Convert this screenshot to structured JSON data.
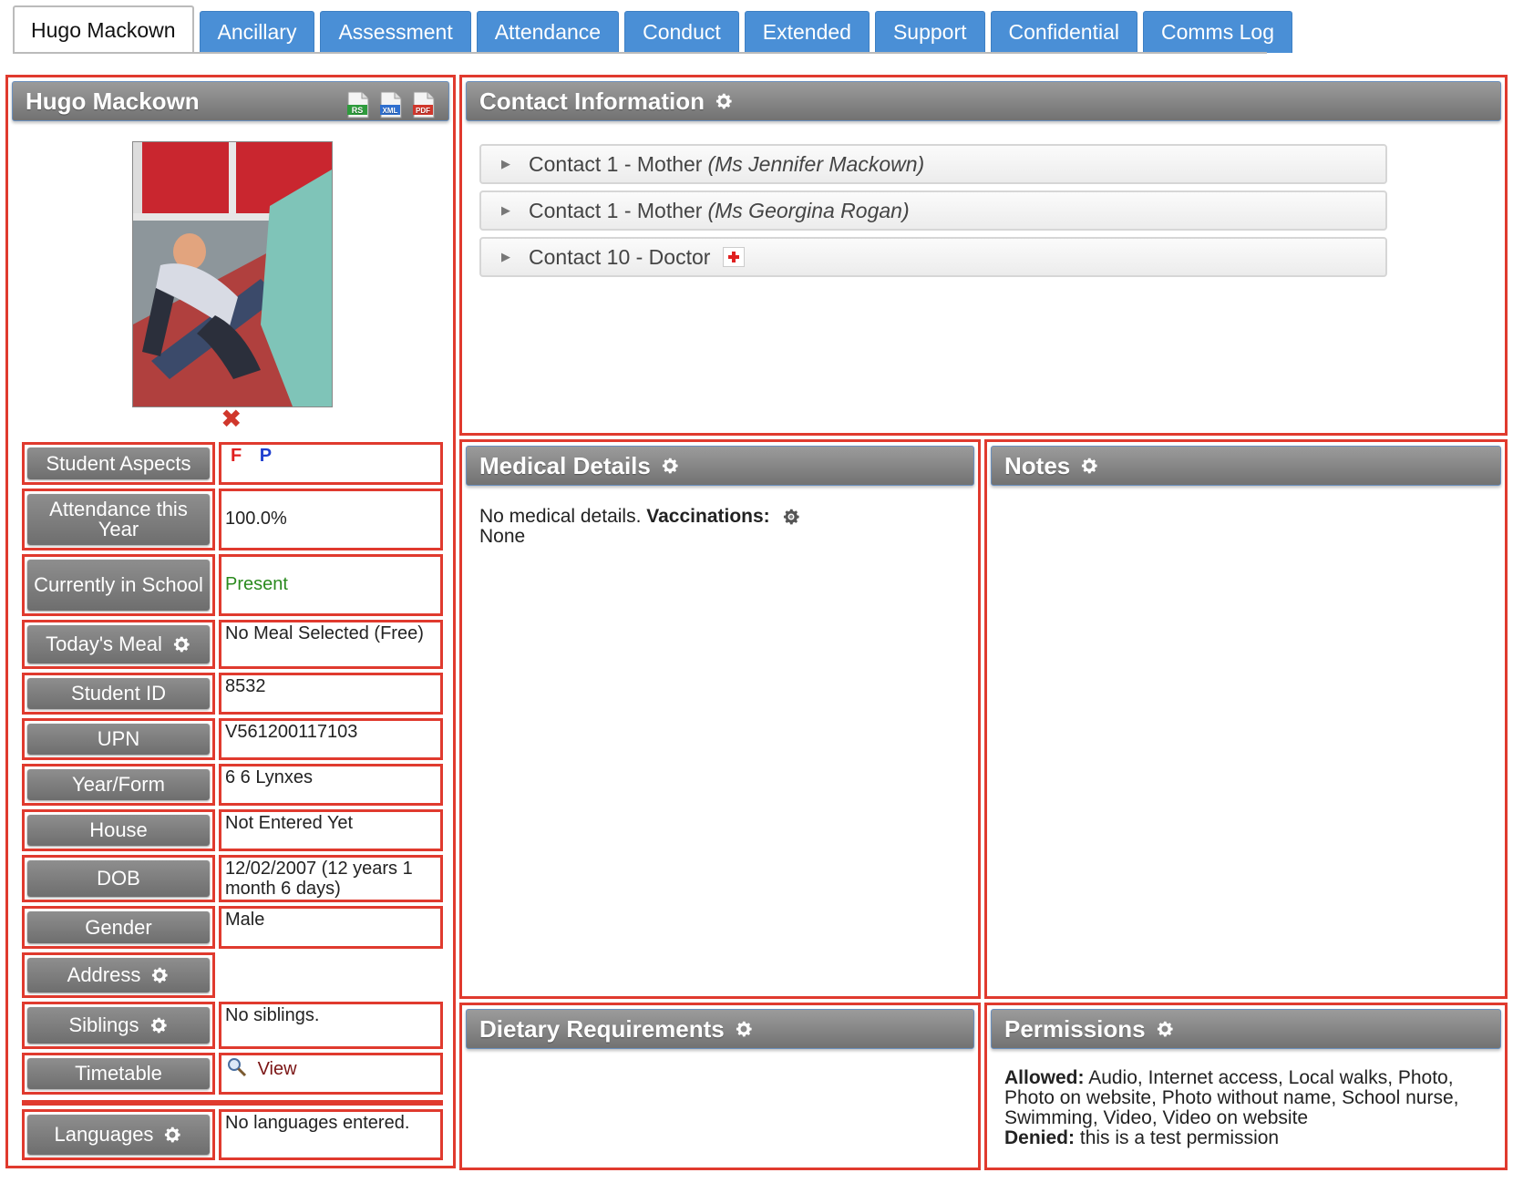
{
  "tabs": [
    {
      "label": "Hugo Mackown",
      "active": true
    },
    {
      "label": "Ancillary"
    },
    {
      "label": "Assessment"
    },
    {
      "label": "Attendance"
    },
    {
      "label": "Conduct"
    },
    {
      "label": "Extended"
    },
    {
      "label": "Support"
    },
    {
      "label": "Confidential"
    },
    {
      "label": "Comms Log"
    }
  ],
  "student": {
    "name": "Hugo Mackown",
    "export_icons": [
      {
        "name": "rs-export-icon",
        "text": "RS",
        "color": "#2e9b3c"
      },
      {
        "name": "xml-export-icon",
        "text": "XML",
        "color": "#2f6fcf"
      },
      {
        "name": "pdf-export-icon",
        "text": "PDF",
        "color": "#d0372c"
      }
    ],
    "delete_photo_glyph": "✖",
    "fields": {
      "aspects": {
        "label": "Student Aspects",
        "f": "F",
        "p": "P"
      },
      "attendance": {
        "label": "Attendance this Year",
        "value": "100.0%"
      },
      "in_school": {
        "label": "Currently in School",
        "value": "Present"
      },
      "meal": {
        "label": "Today's Meal",
        "value": "No Meal Selected (Free)"
      },
      "student_id": {
        "label": "Student ID",
        "value": "8532"
      },
      "upn": {
        "label": "UPN",
        "value": "V561200117103"
      },
      "year_form": {
        "label": "Year/Form",
        "value": "6 6 Lynxes"
      },
      "house": {
        "label": "House",
        "value": "Not Entered Yet"
      },
      "dob": {
        "label": "DOB",
        "value": "12/02/2007 (12 years 1 month 6 days)"
      },
      "gender": {
        "label": "Gender",
        "value": "Male"
      },
      "address": {
        "label": "Address",
        "value": ""
      },
      "siblings": {
        "label": "Siblings",
        "value": "No siblings."
      },
      "timetable": {
        "label": "Timetable",
        "value": "View"
      },
      "languages": {
        "label": "Languages",
        "value": "No languages entered."
      }
    }
  },
  "contact_info": {
    "title": "Contact Information",
    "contacts": [
      {
        "label": "Contact 1 - Mother",
        "name": "(Ms Jennifer Mackown)"
      },
      {
        "label": "Contact 1 - Mother",
        "name": "(Ms Georgina Rogan)"
      },
      {
        "label": "Contact 10 - Doctor",
        "name": ""
      }
    ]
  },
  "medical": {
    "title": "Medical Details",
    "text": "No medical details.",
    "vaccinations_label": "Vaccinations:",
    "vaccinations_value": "None"
  },
  "notes": {
    "title": "Notes"
  },
  "dietary": {
    "title": "Dietary Requirements"
  },
  "permissions": {
    "title": "Permissions",
    "allowed_label": "Allowed:",
    "allowed": "Audio, Internet access, Local walks, Photo, Photo on website, Photo without name, School nurse, Swimming, Video, Video on website",
    "denied_label": "Denied:",
    "denied": "this is a test permission"
  },
  "colors": {
    "accent_tab": "#4a8fd6",
    "outline": "#e03a2e",
    "present": "#2a8a1e",
    "aspect_f": "#e02020",
    "aspect_p": "#1f3fcf"
  }
}
